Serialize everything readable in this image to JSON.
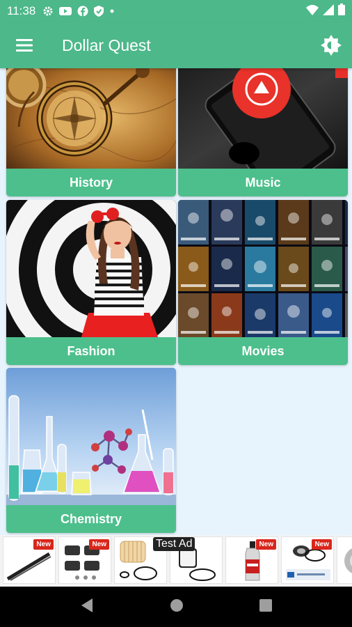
{
  "status_bar": {
    "time": "11:38",
    "icons": [
      "settings-icon",
      "youtube-icon",
      "facebook-icon",
      "shield-icon",
      "dot-icon",
      "wifi-icon",
      "signal-icon",
      "battery-icon"
    ]
  },
  "app_bar": {
    "title": "Dollar Quest",
    "menu_icon": "hamburger-menu-icon",
    "theme_icon": "brightness-icon",
    "color": "#4db88a"
  },
  "categories": [
    {
      "label": "History"
    },
    {
      "label": "Music"
    },
    {
      "label": "Fashion"
    },
    {
      "label": "Movies"
    },
    {
      "label": "Chemistry"
    }
  ],
  "ad_banner": {
    "test_label": "Test Ad",
    "badge": "New",
    "products": [
      "wiper-blade",
      "brake-pads",
      "oil-filter",
      "fuel-filter",
      "additive-bottle",
      "wheel-bearing"
    ]
  },
  "nav_bar": {
    "buttons": [
      "back-icon",
      "home-icon",
      "recents-icon"
    ]
  },
  "colors": {
    "accent": "#4db88a",
    "card_label": "#4dbf8c",
    "background": "#e8f4fd"
  }
}
